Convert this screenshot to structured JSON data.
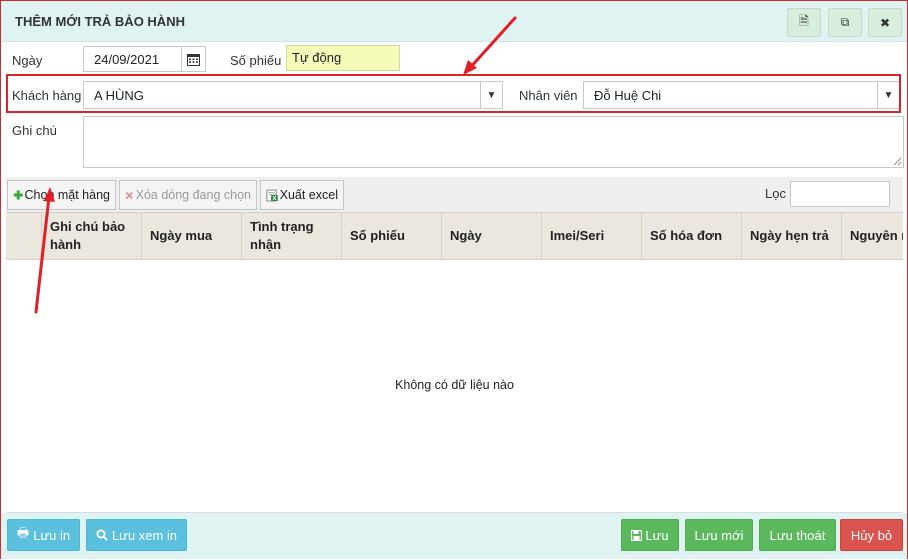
{
  "dialog": {
    "title": "THÊM MỚI TRẢ BẢO HÀNH",
    "title_buttons": [
      {
        "icon": "document-icon",
        "glyph": "🗎"
      },
      {
        "icon": "copy-icon",
        "glyph": "⧉"
      },
      {
        "icon": "close-icon",
        "glyph": "✖"
      }
    ]
  },
  "form": {
    "date_label": "Ngày",
    "date_value": "24/09/2021",
    "voucher_label": "Số phiếu",
    "voucher_value": "Tự động",
    "customer_label": "Khách hàng",
    "customer_value": "A HÙNG",
    "staff_label": "Nhân viên",
    "staff_value": "Đỗ Huệ Chi",
    "note_label": "Ghi chú",
    "note_value": ""
  },
  "toolbar": {
    "choose_items_label": "Chọn mặt hàng",
    "delete_selected_label": "Xóa dòng đang chọn",
    "export_excel_label": "Xuất excel",
    "filter_label": "Lọc",
    "filter_value": ""
  },
  "grid": {
    "columns": [
      "Ghi chú bảo hành",
      "Ngày mua",
      "Tình trạng nhận",
      "Số phiếu",
      "Ngày",
      "Imei/Seri",
      "Số hóa đơn",
      "Ngày hẹn trả",
      "Nguyên nhân"
    ],
    "empty_text": "Không có dữ liệu nào"
  },
  "footer": {
    "print_save_label": "Lưu in",
    "print_preview_label": "Lưu xem in",
    "save_label": "Lưu",
    "save_new_label": "Lưu mới",
    "save_exit_label": "Lưu thoát",
    "cancel_label": "Hủy bỏ"
  },
  "colors": {
    "annotation": "#e31e24",
    "title_bg": "#dff3f3",
    "primary_blue": "#5bc0de",
    "success_green": "#5cb85c",
    "danger_red": "#d9534f",
    "voucher_bg": "#f4fbb8"
  }
}
